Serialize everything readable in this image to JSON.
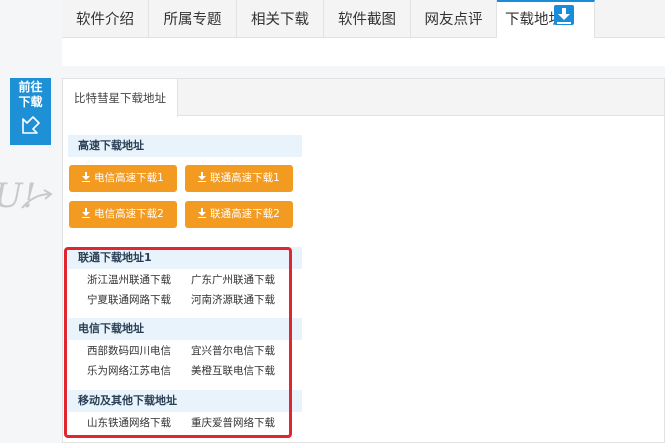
{
  "tabs": [
    {
      "label": "软件介绍"
    },
    {
      "label": "所属专题"
    },
    {
      "label": "相关下载"
    },
    {
      "label": "软件截图"
    },
    {
      "label": "网友点评"
    },
    {
      "label": "下载地址"
    }
  ],
  "jump": {
    "line1": "前往",
    "line2": "下载"
  },
  "ghost": "U!",
  "panel": {
    "tab_label": "比特彗星下载地址"
  },
  "fast": {
    "header": "高速下载地址",
    "buttons": [
      {
        "label": "电信高速下载1"
      },
      {
        "label": "联通高速下载1"
      },
      {
        "label": "电信高速下载2"
      },
      {
        "label": "联通高速下载2"
      }
    ]
  },
  "unicom": {
    "header": "联通下载地址1",
    "links": [
      "浙江温州联通下载",
      "广东广州联通下载",
      "宁夏联通网路下载",
      "河南济源联通下载"
    ]
  },
  "telecom": {
    "header": "电信下载地址",
    "links": [
      "西部数码四川电信",
      "宜兴普尔电信下载",
      "乐为网络江苏电信",
      "美橙互联电信下载"
    ]
  },
  "mobile": {
    "header": "移动及其他下载地址",
    "links": [
      "山东铁通网络下载",
      "重庆爱普网络下载"
    ]
  },
  "colors": {
    "accent": "#1d90d6",
    "button": "#f39a20",
    "highlight": "#e0262f",
    "section_bg": "#e8f3fb"
  }
}
